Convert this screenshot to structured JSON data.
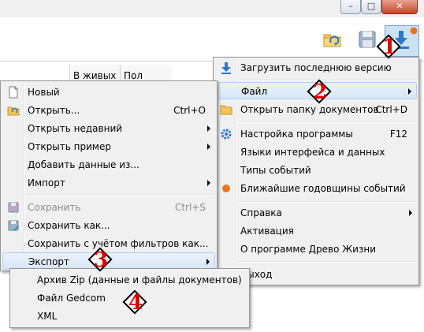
{
  "window": {
    "minimize_glyph": "–",
    "maximize_glyph": "□",
    "close_glyph": "✕"
  },
  "toolbar": {
    "icons": [
      "open-folder-icon",
      "save-icon",
      "download-update-icon"
    ],
    "update_dot_color": "#e87722"
  },
  "grid": {
    "columns": [
      "В живых",
      "Пол"
    ]
  },
  "main_menu": {
    "items": [
      {
        "label": "Загрузить последнюю версию",
        "icon": "download-icon"
      },
      {
        "label": "Файл",
        "submenu": true,
        "highlighted": true
      },
      {
        "label": "Открыть папку документов",
        "shortcut": "Ctrl+D",
        "icon": "folder-icon"
      },
      {
        "label": "Настройка программы",
        "shortcut": "F12",
        "icon": "gear-icon"
      },
      {
        "label": "Языки интерфейса и данных"
      },
      {
        "label": "Типы событий"
      },
      {
        "label": "Ближайшие годовщины событий",
        "icon": "orange-dot-icon"
      },
      {
        "label": "Справка",
        "submenu": true
      },
      {
        "label": "Активация"
      },
      {
        "label": "О программе Древо Жизни"
      },
      {
        "label": "Выход"
      }
    ]
  },
  "file_menu": {
    "items": [
      {
        "label": "Новый",
        "icon": "new-document-icon"
      },
      {
        "label": "Открыть...",
        "shortcut": "Ctrl+O",
        "icon": "open-folder-icon"
      },
      {
        "label": "Открыть недавний",
        "submenu": true
      },
      {
        "label": "Открыть пример",
        "submenu": true
      },
      {
        "label": "Добавить данные из..."
      },
      {
        "label": "Импорт",
        "submenu": true
      },
      {
        "label": "Сохранить",
        "shortcut": "Ctrl+S",
        "disabled": true,
        "icon": "save-icon"
      },
      {
        "label": "Сохранить как...",
        "icon": "save-as-icon"
      },
      {
        "label": "Сохранить с учётом фильтров как..."
      },
      {
        "label": "Экспорт",
        "submenu": true,
        "highlighted": true
      }
    ]
  },
  "export_menu": {
    "items": [
      {
        "label": "Архив Zip (данные и файлы документов)"
      },
      {
        "label": "Файл Gedcom"
      },
      {
        "label": "XML"
      }
    ]
  },
  "callouts": [
    "1",
    "2",
    "3",
    "4"
  ],
  "colors": {
    "callout_number": "#e00000",
    "highlight": "#d7e6f6",
    "accent_blue": "#2f76c9",
    "orange": "#e87722"
  }
}
